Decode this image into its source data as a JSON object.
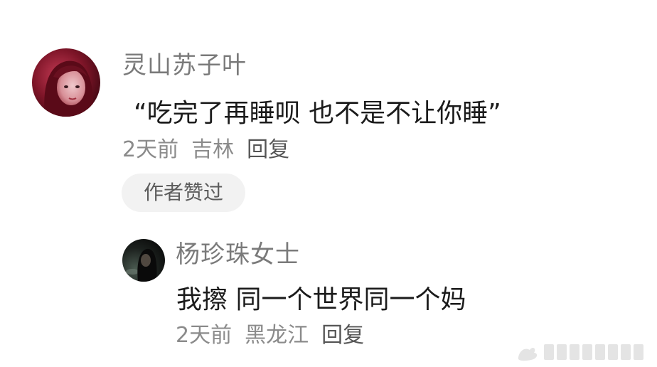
{
  "main_comment": {
    "username": "灵山苏子叶",
    "text": "“吃完了再睡呗 也不是不让你睡”",
    "time": "2天前",
    "location": "吉林",
    "reply_label": "回复",
    "badge": "作者赞过"
  },
  "reply_comment": {
    "username": "杨珍珠女士",
    "text": "我擦 同一个世界同一个妈",
    "time": "2天前",
    "location": "黑龙江",
    "reply_label": "回复"
  },
  "watermark": {
    "text": "",
    "icon": "weibo-watermark-icon"
  },
  "colors": {
    "username": "#7a7a7a",
    "comment_text": "#1b1b1b",
    "meta": "#8b8b8b",
    "badge_bg": "#f2f2f2"
  }
}
